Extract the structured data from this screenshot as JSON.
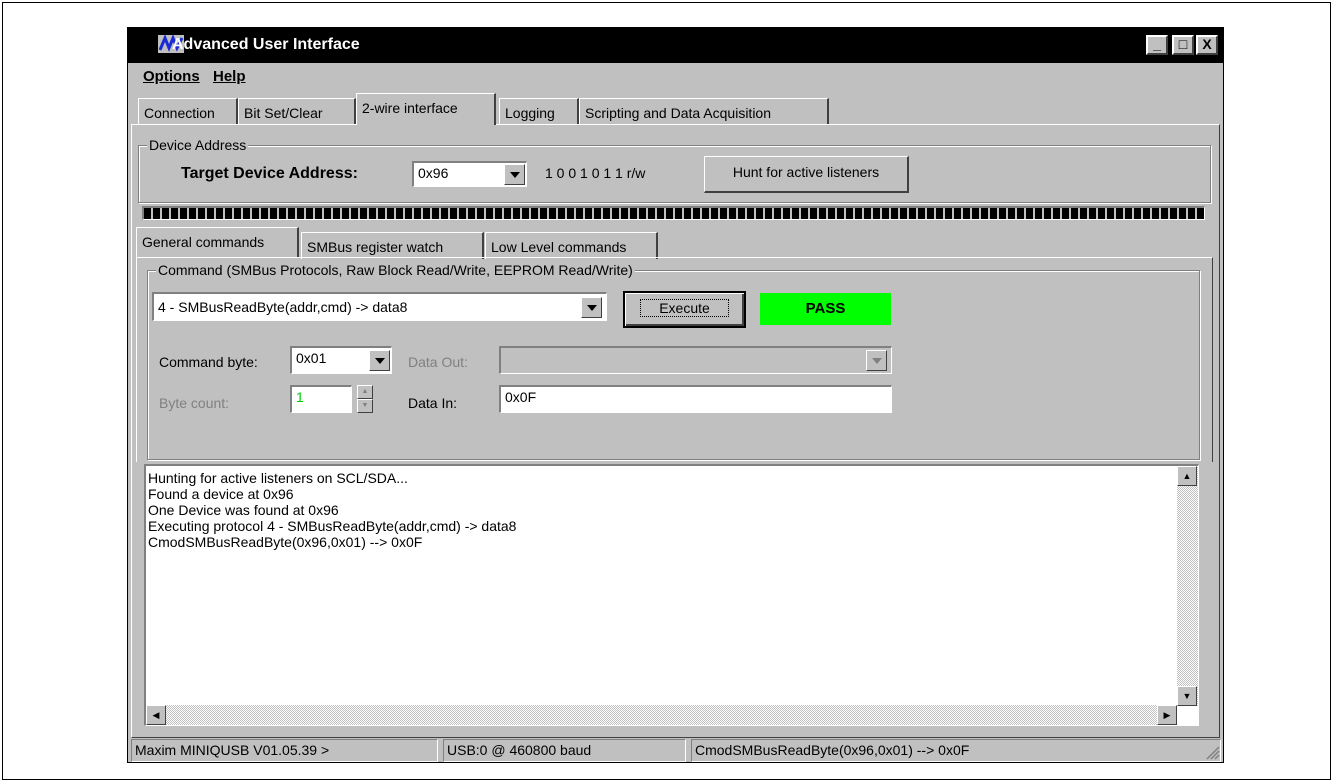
{
  "window": {
    "title": "Advanced User Interface",
    "minimize": "_",
    "maximize": "□",
    "close": "X"
  },
  "menu": {
    "options": "Options",
    "help": "Help"
  },
  "tabs": [
    "Connection",
    "Bit Set/Clear",
    "2-wire interface",
    "Logging",
    "Scripting and Data Acquisition"
  ],
  "device_address": {
    "legend": "Device Address",
    "target_label": "Target Device Address:",
    "target_value": "0x96",
    "bits": "1 0 0 1 0 1 1 r/w",
    "hunt_button": "Hunt for active listeners"
  },
  "progress": {
    "fill_fraction": 1.0
  },
  "subtabs": [
    "General commands",
    "SMBus register watch",
    "Low Level commands"
  ],
  "command_group": {
    "legend": "Command (SMBus Protocols, Raw Block Read/Write, EEPROM Read/Write)",
    "command_value": "4 - SMBusReadByte(addr,cmd) -> data8",
    "execute": "Execute",
    "status": "PASS",
    "command_byte_label": "Command byte:",
    "command_byte_value": "0x01",
    "data_out_label": "Data Out:",
    "data_out_value": "",
    "byte_count_label": "Byte count:",
    "byte_count_value": "1",
    "data_in_label": "Data In:",
    "data_in_value": "0x0F"
  },
  "log_lines": [
    "Hunting for active listeners on SCL/SDA...",
    "Found a device at 0x96",
    "One Device was found at 0x96",
    "Executing protocol 4 - SMBusReadByte(addr,cmd) -> data8",
    "CmodSMBusReadByte(0x96,0x01) --> 0x0F"
  ],
  "status_bar": {
    "pane1": "Maxim MINIQUSB V01.05.39 >",
    "pane2": "USB:0 @ 460800 baud",
    "pane3": "CmodSMBusReadByte(0x96,0x01) --> 0x0F"
  },
  "colors": {
    "pass": "#00ff00",
    "titlebar": "#000000",
    "face": "#c0c0c0"
  }
}
